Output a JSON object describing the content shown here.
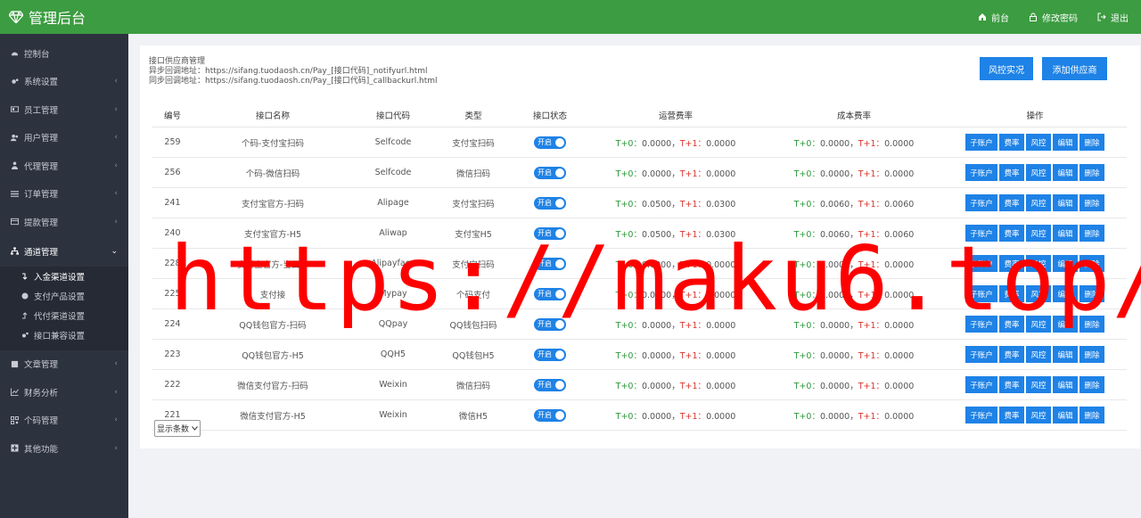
{
  "header": {
    "title": "管理后台",
    "links": [
      {
        "label": "前台",
        "icon": "home-icon"
      },
      {
        "label": "修改密码",
        "icon": "lock-icon"
      },
      {
        "label": "退出",
        "icon": "logout-icon"
      }
    ]
  },
  "sidebar": {
    "items": [
      {
        "label": "控制台",
        "icon": "dashboard-icon",
        "chevron": ""
      },
      {
        "label": "系统设置",
        "icon": "cogs-icon",
        "chevron": "‹"
      },
      {
        "label": "员工管理",
        "icon": "id-card-icon",
        "chevron": "‹"
      },
      {
        "label": "用户管理",
        "icon": "users-icon",
        "chevron": "‹"
      },
      {
        "label": "代理管理",
        "icon": "user-tie-icon",
        "chevron": "‹"
      },
      {
        "label": "订单管理",
        "icon": "list-icon",
        "chevron": "‹"
      },
      {
        "label": "提款管理",
        "icon": "card-icon",
        "chevron": "‹"
      },
      {
        "label": "通道管理",
        "icon": "sitemap-icon",
        "chevron": "⌄"
      }
    ],
    "subitems": [
      {
        "label": "入金渠道设置",
        "icon": "level-down-icon"
      },
      {
        "label": "支付产品设置",
        "icon": "coin-icon"
      },
      {
        "label": "代付渠道设置",
        "icon": "level-up-icon"
      },
      {
        "label": "接口兼容设置",
        "icon": "cogs-icon"
      }
    ],
    "items_after": [
      {
        "label": "文章管理",
        "icon": "book-icon",
        "chevron": "‹"
      },
      {
        "label": "财务分析",
        "icon": "chart-icon",
        "chevron": "‹"
      },
      {
        "label": "个码管理",
        "icon": "qrcode-icon",
        "chevron": "‹"
      },
      {
        "label": "其他功能",
        "icon": "plus-square-icon",
        "chevron": "‹"
      }
    ]
  },
  "info": {
    "title": "接口供应商管理",
    "async_url": "异步回调地址：https://sifang.tuodaosh.cn/Pay_[接口代码]_notifyurl.html",
    "sync_url": "同步回调地址：https://sifang.tuodaosh.cn/Pay_[接口代码]_callbackurl.html"
  },
  "buttons": {
    "risk": "风控实况",
    "add": "添加供应商"
  },
  "table": {
    "headers": [
      "编号",
      "接口名称",
      "接口代码",
      "类型",
      "接口状态",
      "运营费率",
      "成本费率",
      "操作"
    ],
    "toggle_label": "开启",
    "op_labels": [
      "子账户",
      "费率",
      "风控",
      "编辑",
      "删除"
    ],
    "rows": [
      {
        "id": "259",
        "name": "个码-支付宝扫码",
        "code": "Selfcode",
        "type": "支付宝扫码",
        "op_t0": "0.0000",
        "op_t1": "0.0000",
        "cost_t0": "0.0000",
        "cost_t1": "0.0000"
      },
      {
        "id": "256",
        "name": "个码-微信扫码",
        "code": "Selfcode",
        "type": "微信扫码",
        "op_t0": "0.0000",
        "op_t1": "0.0000",
        "cost_t0": "0.0000",
        "cost_t1": "0.0000"
      },
      {
        "id": "241",
        "name": "支付宝官方-扫码",
        "code": "Alipage",
        "type": "支付宝扫码",
        "op_t0": "0.0500",
        "op_t1": "0.0300",
        "cost_t0": "0.0060",
        "cost_t1": "0.0060"
      },
      {
        "id": "240",
        "name": "支付宝官方-H5",
        "code": "Aliwap",
        "type": "支付宝H5",
        "op_t0": "0.0500",
        "op_t1": "0.0300",
        "cost_t0": "0.0060",
        "cost_t1": "0.0060"
      },
      {
        "id": "228",
        "name": "支付宝官方-当面付",
        "code": "Alipayface",
        "type": "支付宝扫码",
        "op_t0": "0.0000",
        "op_t1": "0.0000",
        "cost_t0": "0.0000",
        "cost_t1": "0.0000"
      },
      {
        "id": "225",
        "name": "支付接",
        "code": "Mypay",
        "type": "个码支付",
        "op_t0": "0.0000",
        "op_t1": "0.0000",
        "cost_t0": "0.0000",
        "cost_t1": "0.0000"
      },
      {
        "id": "224",
        "name": "QQ钱包官方-扫码",
        "code": "QQpay",
        "type": "QQ钱包扫码",
        "op_t0": "0.0000",
        "op_t1": "0.0000",
        "cost_t0": "0.0000",
        "cost_t1": "0.0000"
      },
      {
        "id": "223",
        "name": "QQ钱包官方-H5",
        "code": "QQH5",
        "type": "QQ钱包H5",
        "op_t0": "0.0000",
        "op_t1": "0.0000",
        "cost_t0": "0.0000",
        "cost_t1": "0.0000"
      },
      {
        "id": "222",
        "name": "微信支付官方-扫码",
        "code": "Weixin",
        "type": "微信扫码",
        "op_t0": "0.0000",
        "op_t1": "0.0000",
        "cost_t0": "0.0000",
        "cost_t1": "0.0000"
      },
      {
        "id": "221",
        "name": "微信支付官方-H5",
        "code": "Weixin",
        "type": "微信H5",
        "op_t0": "0.0000",
        "op_t1": "0.0000",
        "cost_t0": "0.0000",
        "cost_t1": "0.0000"
      }
    ]
  },
  "rate_labels": {
    "t0": "T+0：",
    "sep": "，",
    "t1": "T+1："
  },
  "page_size_label": "显示条数",
  "watermark": "https://maku6.top/",
  "colors": {
    "header": "#3c9c41",
    "sidebar": "#2d323f",
    "primary": "#1e82e6",
    "rate_green": "#2e9a3c",
    "rate_red": "#d9342b",
    "watermark": "#ff0000"
  }
}
